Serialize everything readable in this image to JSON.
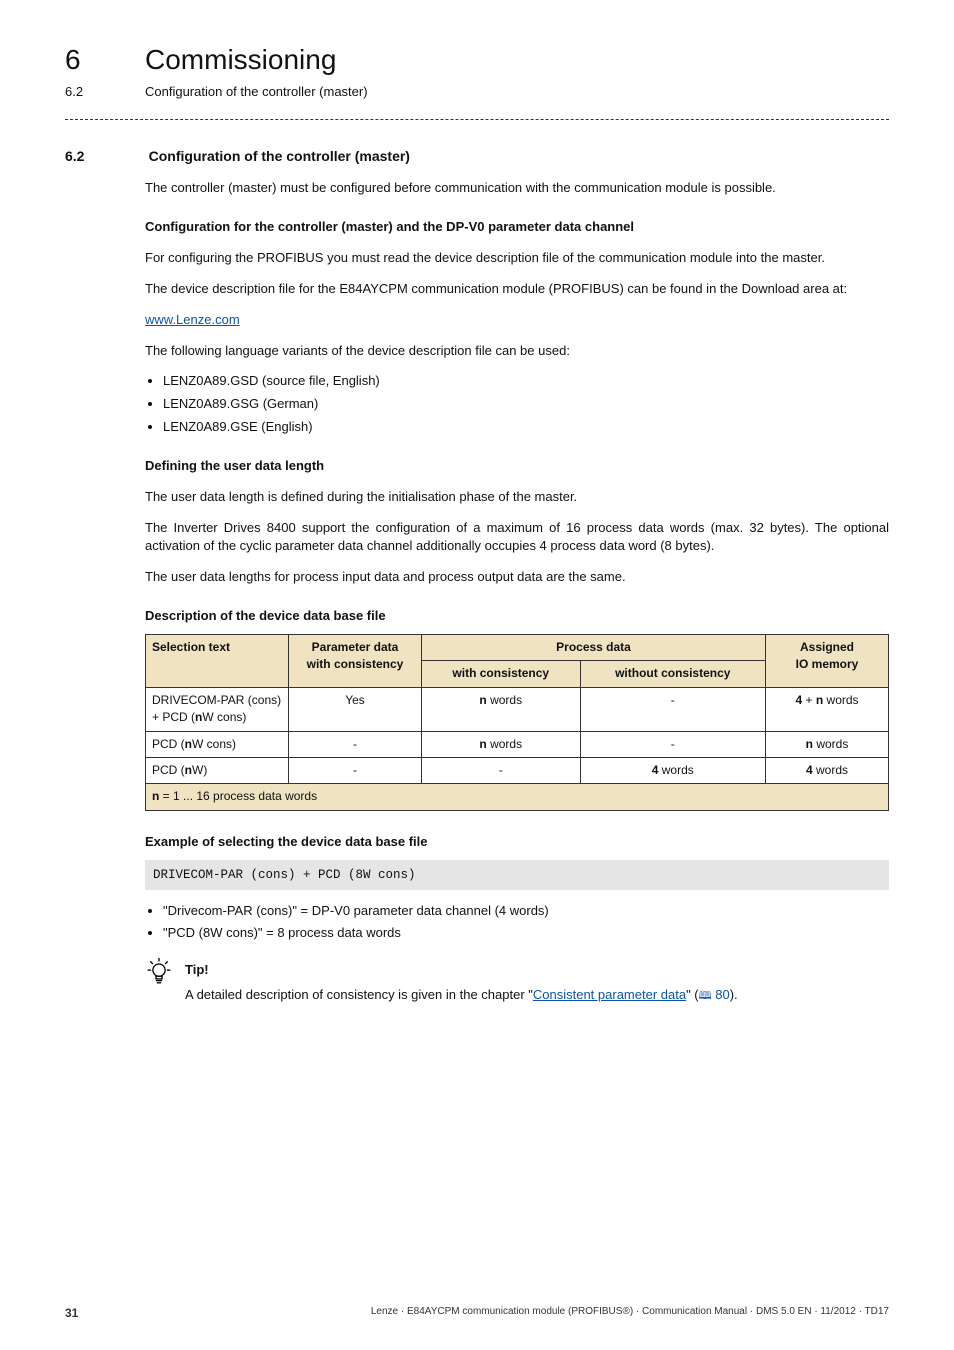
{
  "header": {
    "chapter_num": "6",
    "chapter_title": "Commissioning",
    "sub_num": "6.2",
    "sub_title": "Configuration of the controller (master)"
  },
  "section": {
    "num": "6.2",
    "title": "Configuration of the controller (master)",
    "intro": "The controller (master) must be configured before communication with the communication module is possible.",
    "sub1_title": "Configuration for the controller (master) and the DP-V0 parameter data channel",
    "sub1_p1": "For configuring the PROFIBUS you must read the device description file of the communication module into the master.",
    "sub1_p2": "The device description file for the E84AYCPM communication module (PROFIBUS) can be found in the Download area at:",
    "link": "www.Lenze.com",
    "sub1_p3": "The following language variants of the device description file can be used:",
    "files": [
      "LENZ0A89.GSD (source file, English)",
      "LENZ0A89.GSG (German)",
      "LENZ0A89.GSE (English)"
    ],
    "sub2_title": "Defining the user data length",
    "sub2_p1": "The user data length is defined during the initialisation phase of the master.",
    "sub2_p2": "The Inverter Drives 8400 support the configuration of a maximum of 16 process data words (max. 32 bytes). The optional activation of the cyclic parameter data channel additionally occupies 4 process data word (8 bytes).",
    "sub2_p3": "The user data lengths for process input data and process output data are the same.",
    "sub3_title": "Description of the device data base file",
    "table": {
      "h_sel": "Selection text",
      "h_param_l1": "Parameter data",
      "h_param_l2": "with consistency",
      "h_proc": "Process data",
      "h_proc_with": "with consistency",
      "h_proc_without": "without consistency",
      "h_assigned_l1": "Assigned",
      "h_assigned_l2": "IO memory",
      "rows": [
        {
          "sel_html": "DRIVECOM-PAR (cons) + PCD (<b>n</b>W cons)",
          "param": "Yes",
          "with_html": "<b>n</b> words",
          "without": "-",
          "io_html": "<b>4</b> + <b>n</b> words"
        },
        {
          "sel_html": "PCD (<b>n</b>W cons)",
          "param": "-",
          "with_html": "<b>n</b> words",
          "without": "-",
          "io_html": "<b>n</b> words"
        },
        {
          "sel_html": "PCD (<b>n</b>W)",
          "param": "-",
          "with_html": "-",
          "without_html": "<b>4</b> words",
          "io_html": "<b>4</b> words"
        }
      ],
      "footer_html": "<b>n</b> = 1 ... 16 process data words"
    },
    "sub4_title": "Example of selecting the device data base file",
    "code": "DRIVECOM-PAR (cons) + PCD (8W cons)",
    "example_items": [
      "\"Drivecom-PAR (cons)\" = DP-V0 parameter data channel (4 words)",
      "\"PCD (8W cons)\" = 8 process data words"
    ],
    "tip_title": "Tip!",
    "tip_body_pre": "A detailed description of consistency is given in the chapter \"",
    "tip_link": "Consistent parameter data",
    "tip_body_post": "\" (",
    "tip_page": "80",
    "tip_close": ")."
  },
  "footer": {
    "page": "31",
    "info": "Lenze · E84AYCPM communication module (PROFIBUS®) · Communication Manual · DMS 5.0 EN · 11/2012 · TD17"
  }
}
